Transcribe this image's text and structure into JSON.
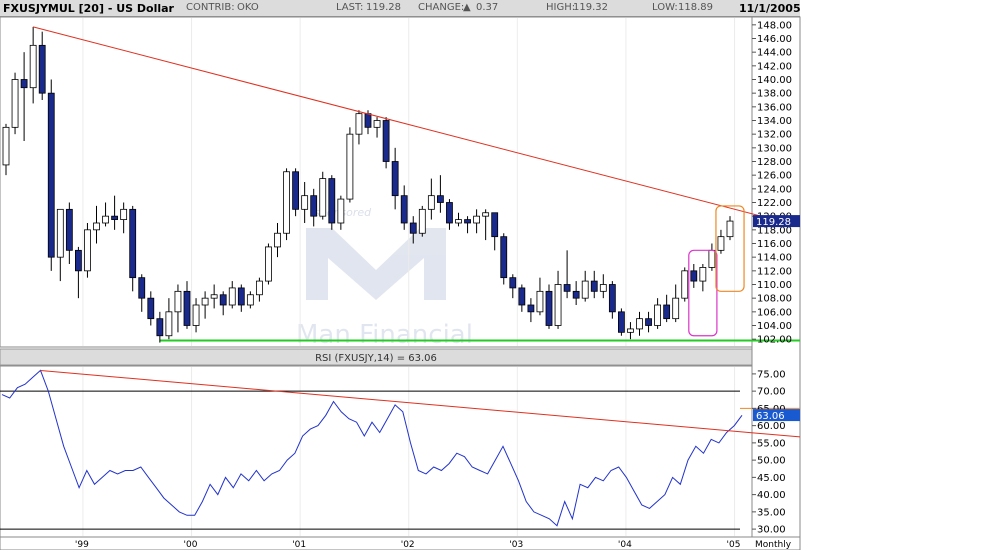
{
  "header": {
    "symbol": "FXUSJYMUL [20] - US Dollar",
    "contrib_label": "CONTRIB:",
    "contrib_value": "OKO",
    "last_label": "LAST:",
    "last_value": "119.28",
    "change_label": "CHANGE:",
    "change_value": "0.37",
    "high_label": "HIGH:",
    "high_value": "119.32",
    "low_label": "LOW:",
    "low_value": "118.89",
    "date": "11/1/2005"
  },
  "watermark": {
    "sponsor_text": "sponsored",
    "brand_text": "Man Financial"
  },
  "colors": {
    "up_candle": "#ffffff",
    "down_candle": "#1a2a8c",
    "trendline": "#e03020",
    "support": "#22cc22",
    "rsi_line": "#2233cc",
    "last_tag": "#1a2a8c",
    "magenta_box": "#dd33cc",
    "orange_box": "#ee8822"
  },
  "chart_data": [
    {
      "type": "candlestick",
      "title": "",
      "frequency": "Monthly",
      "frequency_label": "Monthly",
      "ylim": [
        101,
        149
      ],
      "yticks": [
        "102.00",
        "104.00",
        "106.00",
        "108.00",
        "110.00",
        "112.00",
        "114.00",
        "116.00",
        "118.00",
        "120.00",
        "122.00",
        "124.00",
        "126.00",
        "128.00",
        "130.00",
        "132.00",
        "134.00",
        "136.00",
        "138.00",
        "140.00",
        "142.00",
        "144.00",
        "146.00",
        "148.00"
      ],
      "last_price": "119.28",
      "x_labels": [
        "'99",
        "'00",
        "'01",
        "'02",
        "'03",
        "'04",
        "'05"
      ],
      "candles": [
        {
          "o": 127.5,
          "h": 133.5,
          "l": 126.0,
          "c": 133.0
        },
        {
          "o": 133.0,
          "h": 141.0,
          "l": 132.0,
          "c": 140.0
        },
        {
          "o": 140.0,
          "h": 144.0,
          "l": 131.0,
          "c": 138.8
        },
        {
          "o": 138.8,
          "h": 147.7,
          "l": 136.5,
          "c": 145.0
        },
        {
          "o": 145.0,
          "h": 147.0,
          "l": 137.0,
          "c": 138.0
        },
        {
          "o": 138.0,
          "h": 140.0,
          "l": 112.0,
          "c": 114.0
        },
        {
          "o": 114.0,
          "h": 121.0,
          "l": 110.5,
          "c": 121.0
        },
        {
          "o": 121.0,
          "h": 122.0,
          "l": 113.0,
          "c": 115.0
        },
        {
          "o": 115.0,
          "h": 115.5,
          "l": 108.0,
          "c": 112.0
        },
        {
          "o": 112.0,
          "h": 119.0,
          "l": 111.0,
          "c": 118.0
        },
        {
          "o": 118.0,
          "h": 121.5,
          "l": 116.0,
          "c": 119.0
        },
        {
          "o": 119.0,
          "h": 122.0,
          "l": 118.5,
          "c": 120.0
        },
        {
          "o": 120.0,
          "h": 123.0,
          "l": 118.0,
          "c": 119.5
        },
        {
          "o": 119.5,
          "h": 122.0,
          "l": 117.5,
          "c": 121.0
        },
        {
          "o": 121.0,
          "h": 121.5,
          "l": 109.0,
          "c": 111.0
        },
        {
          "o": 111.0,
          "h": 111.5,
          "l": 106.0,
          "c": 108.0
        },
        {
          "o": 108.0,
          "h": 109.0,
          "l": 104.0,
          "c": 105.0
        },
        {
          "o": 105.0,
          "h": 106.0,
          "l": 101.5,
          "c": 102.5
        },
        {
          "o": 102.5,
          "h": 108.0,
          "l": 102.0,
          "c": 106.0
        },
        {
          "o": 106.0,
          "h": 110.0,
          "l": 103.0,
          "c": 109.0
        },
        {
          "o": 109.0,
          "h": 110.5,
          "l": 103.5,
          "c": 104.0
        },
        {
          "o": 104.0,
          "h": 108.0,
          "l": 103.0,
          "c": 107.0
        },
        {
          "o": 107.0,
          "h": 109.0,
          "l": 105.0,
          "c": 108.0
        },
        {
          "o": 108.0,
          "h": 110.0,
          "l": 106.5,
          "c": 108.5
        },
        {
          "o": 108.5,
          "h": 109.0,
          "l": 105.5,
          "c": 107.0
        },
        {
          "o": 107.0,
          "h": 110.5,
          "l": 106.5,
          "c": 109.5
        },
        {
          "o": 109.5,
          "h": 110.0,
          "l": 106.0,
          "c": 107.0
        },
        {
          "o": 107.0,
          "h": 109.0,
          "l": 106.5,
          "c": 108.5
        },
        {
          "o": 108.5,
          "h": 111.0,
          "l": 107.5,
          "c": 110.5
        },
        {
          "o": 110.5,
          "h": 116.0,
          "l": 110.0,
          "c": 115.5
        },
        {
          "o": 115.5,
          "h": 119.0,
          "l": 114.0,
          "c": 117.5
        },
        {
          "o": 117.5,
          "h": 127.0,
          "l": 116.5,
          "c": 126.5
        },
        {
          "o": 126.5,
          "h": 127.0,
          "l": 120.0,
          "c": 121.0
        },
        {
          "o": 121.0,
          "h": 125.0,
          "l": 119.0,
          "c": 123.0
        },
        {
          "o": 123.0,
          "h": 124.0,
          "l": 118.5,
          "c": 120.0
        },
        {
          "o": 120.0,
          "h": 126.5,
          "l": 119.5,
          "c": 125.5
        },
        {
          "o": 125.5,
          "h": 126.0,
          "l": 118.0,
          "c": 119.0
        },
        {
          "o": 119.0,
          "h": 123.0,
          "l": 118.0,
          "c": 122.5
        },
        {
          "o": 122.5,
          "h": 133.0,
          "l": 122.0,
          "c": 132.0
        },
        {
          "o": 132.0,
          "h": 135.5,
          "l": 130.5,
          "c": 135.0
        },
        {
          "o": 135.0,
          "h": 135.5,
          "l": 132.0,
          "c": 133.0
        },
        {
          "o": 133.0,
          "h": 134.5,
          "l": 131.5,
          "c": 134.0
        },
        {
          "o": 134.0,
          "h": 134.5,
          "l": 127.0,
          "c": 128.0
        },
        {
          "o": 128.0,
          "h": 130.0,
          "l": 121.0,
          "c": 123.0
        },
        {
          "o": 123.0,
          "h": 124.5,
          "l": 118.0,
          "c": 119.0
        },
        {
          "o": 119.0,
          "h": 120.0,
          "l": 116.0,
          "c": 117.5
        },
        {
          "o": 117.5,
          "h": 121.5,
          "l": 117.0,
          "c": 121.0
        },
        {
          "o": 121.0,
          "h": 125.5,
          "l": 119.5,
          "c": 123.0
        },
        {
          "o": 123.0,
          "h": 126.0,
          "l": 120.5,
          "c": 122.0
        },
        {
          "o": 122.0,
          "h": 122.5,
          "l": 118.0,
          "c": 119.0
        },
        {
          "o": 119.0,
          "h": 120.5,
          "l": 118.5,
          "c": 119.5
        },
        {
          "o": 119.5,
          "h": 120.0,
          "l": 117.5,
          "c": 119.0
        },
        {
          "o": 119.0,
          "h": 121.0,
          "l": 117.5,
          "c": 120.0
        },
        {
          "o": 120.0,
          "h": 121.0,
          "l": 116.5,
          "c": 120.5
        },
        {
          "o": 120.5,
          "h": 120.5,
          "l": 115.0,
          "c": 117.0
        },
        {
          "o": 117.0,
          "h": 117.5,
          "l": 110.0,
          "c": 111.0
        },
        {
          "o": 111.0,
          "h": 111.5,
          "l": 108.0,
          "c": 109.5
        },
        {
          "o": 109.5,
          "h": 110.0,
          "l": 106.0,
          "c": 107.0
        },
        {
          "o": 107.0,
          "h": 108.0,
          "l": 104.5,
          "c": 106.0
        },
        {
          "o": 106.0,
          "h": 111.0,
          "l": 105.5,
          "c": 109.0
        },
        {
          "o": 109.0,
          "h": 110.0,
          "l": 103.5,
          "c": 104.0
        },
        {
          "o": 104.0,
          "h": 112.0,
          "l": 103.5,
          "c": 110.0
        },
        {
          "o": 110.0,
          "h": 115.0,
          "l": 108.0,
          "c": 109.0
        },
        {
          "o": 109.0,
          "h": 110.5,
          "l": 107.0,
          "c": 108.0
        },
        {
          "o": 108.0,
          "h": 112.0,
          "l": 107.5,
          "c": 110.5
        },
        {
          "o": 110.5,
          "h": 112.0,
          "l": 108.0,
          "c": 109.0
        },
        {
          "o": 109.0,
          "h": 111.5,
          "l": 108.0,
          "c": 110.0
        },
        {
          "o": 110.0,
          "h": 110.5,
          "l": 105.0,
          "c": 106.0
        },
        {
          "o": 106.0,
          "h": 106.5,
          "l": 102.5,
          "c": 103.0
        },
        {
          "o": 103.0,
          "h": 104.5,
          "l": 102.0,
          "c": 103.5
        },
        {
          "o": 103.5,
          "h": 106.0,
          "l": 102.5,
          "c": 105.0
        },
        {
          "o": 105.0,
          "h": 106.0,
          "l": 103.0,
          "c": 104.0
        },
        {
          "o": 104.0,
          "h": 108.0,
          "l": 103.5,
          "c": 107.0
        },
        {
          "o": 107.0,
          "h": 108.5,
          "l": 104.5,
          "c": 105.0
        },
        {
          "o": 105.0,
          "h": 110.0,
          "l": 104.5,
          "c": 108.0
        },
        {
          "o": 108.0,
          "h": 112.5,
          "l": 107.5,
          "c": 112.0
        },
        {
          "o": 112.0,
          "h": 113.0,
          "l": 109.5,
          "c": 110.5
        },
        {
          "o": 110.5,
          "h": 113.0,
          "l": 109.0,
          "c": 112.5
        },
        {
          "o": 112.5,
          "h": 116.0,
          "l": 112.0,
          "c": 115.0
        },
        {
          "o": 115.0,
          "h": 118.0,
          "l": 114.5,
          "c": 117.0
        },
        {
          "o": 117.0,
          "h": 120.0,
          "l": 116.5,
          "c": 119.28
        }
      ],
      "trendline": {
        "from": {
          "index": 3,
          "value": 147.7
        },
        "to": {
          "index": 82,
          "value": 120.5
        }
      },
      "support": {
        "value": 101.8
      },
      "annotations": [
        {
          "type": "box",
          "color": "magenta",
          "index_from": 76,
          "index_to": 78,
          "low": 102.5,
          "high": 115.0
        },
        {
          "type": "box",
          "color": "orange",
          "index_from": 79,
          "index_to": 81,
          "low": 109.0,
          "high": 121.5
        }
      ]
    },
    {
      "type": "line",
      "title": "RSI (FXUSJY,14) = 63.06",
      "ylim": [
        28,
        77
      ],
      "yticks": [
        "30.00",
        "35.00",
        "40.00",
        "45.00",
        "50.00",
        "55.00",
        "60.00",
        "65.00",
        "70.00",
        "75.00"
      ],
      "last_value": "63.06",
      "reference_lines": [
        70,
        30
      ],
      "series": [
        {
          "values": [
            69,
            68,
            71,
            72,
            74,
            76,
            70,
            62,
            54,
            48,
            42,
            47,
            43,
            45,
            47,
            46,
            47,
            47,
            48,
            45,
            42,
            39,
            37,
            35,
            34,
            34,
            38,
            43,
            40,
            45,
            42,
            46,
            44,
            47,
            44,
            46,
            47,
            50,
            52,
            57,
            59,
            60,
            63,
            67,
            64,
            62,
            61,
            57,
            61,
            58,
            62,
            66,
            64,
            55,
            47,
            46,
            48,
            47,
            49,
            52,
            51,
            48,
            47,
            46,
            50,
            54,
            49,
            44,
            38,
            35,
            34,
            33,
            31,
            38,
            33,
            43,
            42,
            45,
            44,
            47,
            48,
            45,
            41,
            37,
            36,
            38,
            40,
            45,
            43,
            50,
            54,
            52,
            56,
            55,
            58,
            60,
            63
          ]
        }
      ],
      "trendline": {
        "from": {
          "index": 5,
          "value": 76.0
        },
        "to": {
          "index": 97,
          "value": 58.0
        }
      }
    }
  ]
}
